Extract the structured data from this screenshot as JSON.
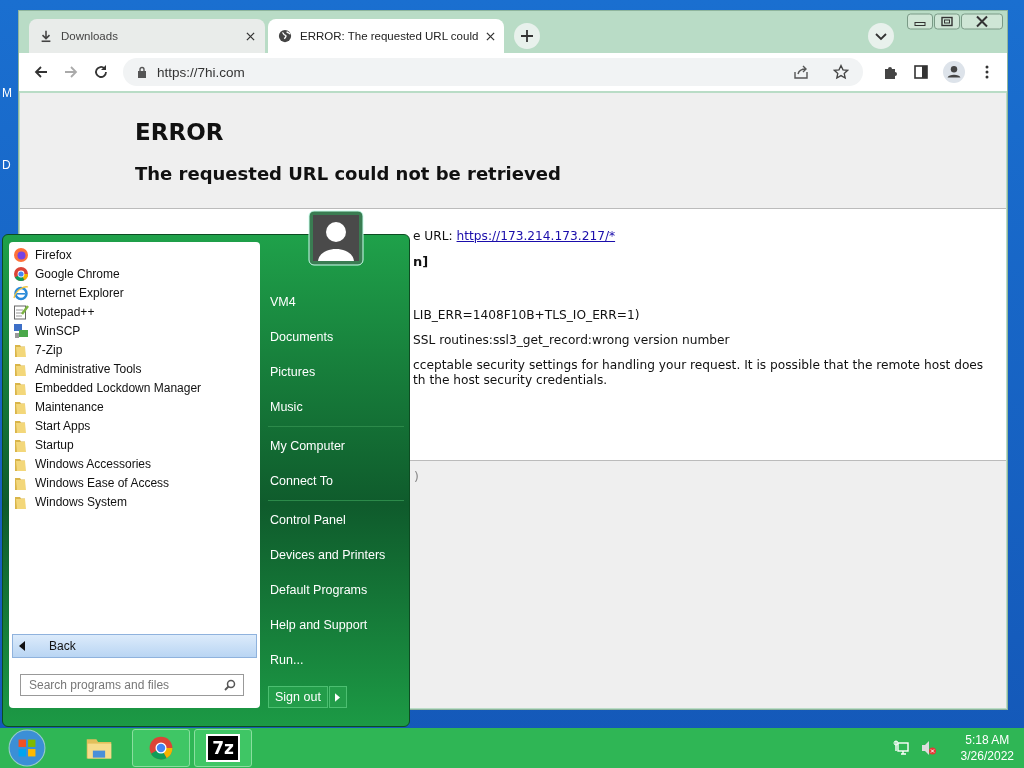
{
  "desktop": {
    "labels": [
      "M",
      "D"
    ]
  },
  "browser": {
    "tabs": [
      {
        "kind": "download",
        "title": "Downloads",
        "selected": false
      },
      {
        "kind": "globe",
        "title": "ERROR: The requested URL could",
        "selected": true
      }
    ],
    "address": "https://7hi.com",
    "page": {
      "heading": "ERROR",
      "subheading": "The requested URL could not be retrieved",
      "lines": [
        {
          "kind": "link",
          "text": "e URL: ",
          "link": "https://173.214.173.217/*"
        },
        {
          "kind": "bold",
          "text": "n]"
        },
        {
          "kind": "gap"
        },
        {
          "kind": "plain",
          "text": "LIB_ERR=1408F10B+TLS_IO_ERR=1)"
        },
        {
          "kind": "plain",
          "text": "SSL routines:ssl3_get_record:wrong version number"
        },
        {
          "kind": "plain",
          "text": "cceptable security settings for handling your request. It is possible that the remote host does th the host security credentials."
        }
      ],
      "footer": ")"
    }
  },
  "start_menu": {
    "programs": [
      {
        "kind": "firefox",
        "name": "Firefox"
      },
      {
        "kind": "chrome",
        "name": "Google Chrome"
      },
      {
        "kind": "ie",
        "name": "Internet Explorer"
      },
      {
        "kind": "notepad",
        "name": "Notepad++"
      },
      {
        "kind": "winscp",
        "name": "WinSCP"
      },
      {
        "kind": "folder",
        "name": "7-Zip"
      },
      {
        "kind": "folder",
        "name": "Administrative Tools"
      },
      {
        "kind": "folder",
        "name": "Embedded Lockdown Manager"
      },
      {
        "kind": "folder",
        "name": "Maintenance"
      },
      {
        "kind": "folder",
        "name": "Start Apps"
      },
      {
        "kind": "folder",
        "name": "Startup"
      },
      {
        "kind": "folder",
        "name": "Windows Accessories"
      },
      {
        "kind": "folder",
        "name": "Windows Ease of Access"
      },
      {
        "kind": "folder",
        "name": "Windows System"
      }
    ],
    "back": "Back",
    "search": {
      "placeholder": "Search programs and files"
    },
    "place_groups": [
      {
        "items": [
          "VM4",
          "Documents",
          "Pictures",
          "Music"
        ]
      },
      {
        "items": [
          "My Computer",
          "Connect To"
        ]
      },
      {
        "items": [
          "Control Panel",
          "Devices and Printers",
          "Default Programs",
          "Help and Support",
          "Run..."
        ]
      }
    ],
    "sign_out": "Sign out"
  },
  "taskbar": {
    "buttons": [
      {
        "kind": "explorer",
        "running": false
      },
      {
        "kind": "chrome",
        "running": true
      },
      {
        "kind": "sevenzip",
        "label": "7z",
        "running": true
      }
    ],
    "clock": {
      "time": "5:18 AM",
      "date": "3/26/2022"
    }
  }
}
